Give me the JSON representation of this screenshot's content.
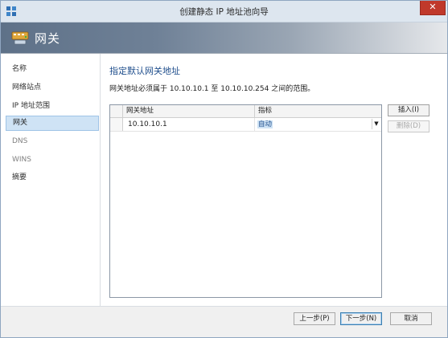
{
  "window": {
    "title": "创建静态 IP 地址池向导",
    "close_label": "✕"
  },
  "banner": {
    "title": "网关"
  },
  "sidebar": {
    "items": [
      {
        "label": "名称",
        "state": "done"
      },
      {
        "label": "网络站点",
        "state": "done"
      },
      {
        "label": "IP 地址范围",
        "state": "done"
      },
      {
        "label": "网关",
        "state": "active"
      },
      {
        "label": "DNS",
        "state": "pending"
      },
      {
        "label": "WINS",
        "state": "pending"
      },
      {
        "label": "摘要",
        "state": "done"
      }
    ]
  },
  "main": {
    "heading": "指定默认网关地址",
    "description": "网关地址必须属于 10.10.10.1 至 10.10.10.254 之间的范围。",
    "grid": {
      "columns": [
        "网关地址",
        "指标"
      ],
      "rows": [
        {
          "gateway": "10.10.10.1",
          "metric": "自动"
        }
      ]
    },
    "insert_button": "插入(I)",
    "delete_button": "删除(D)"
  },
  "footer": {
    "prev_button": "上一步(P)",
    "next_button": "下一步(N)",
    "cancel_button": "取消"
  },
  "colors": {
    "accent": "#1f4e8c",
    "selection": "#cfe3f5",
    "close": "#c0392b"
  }
}
